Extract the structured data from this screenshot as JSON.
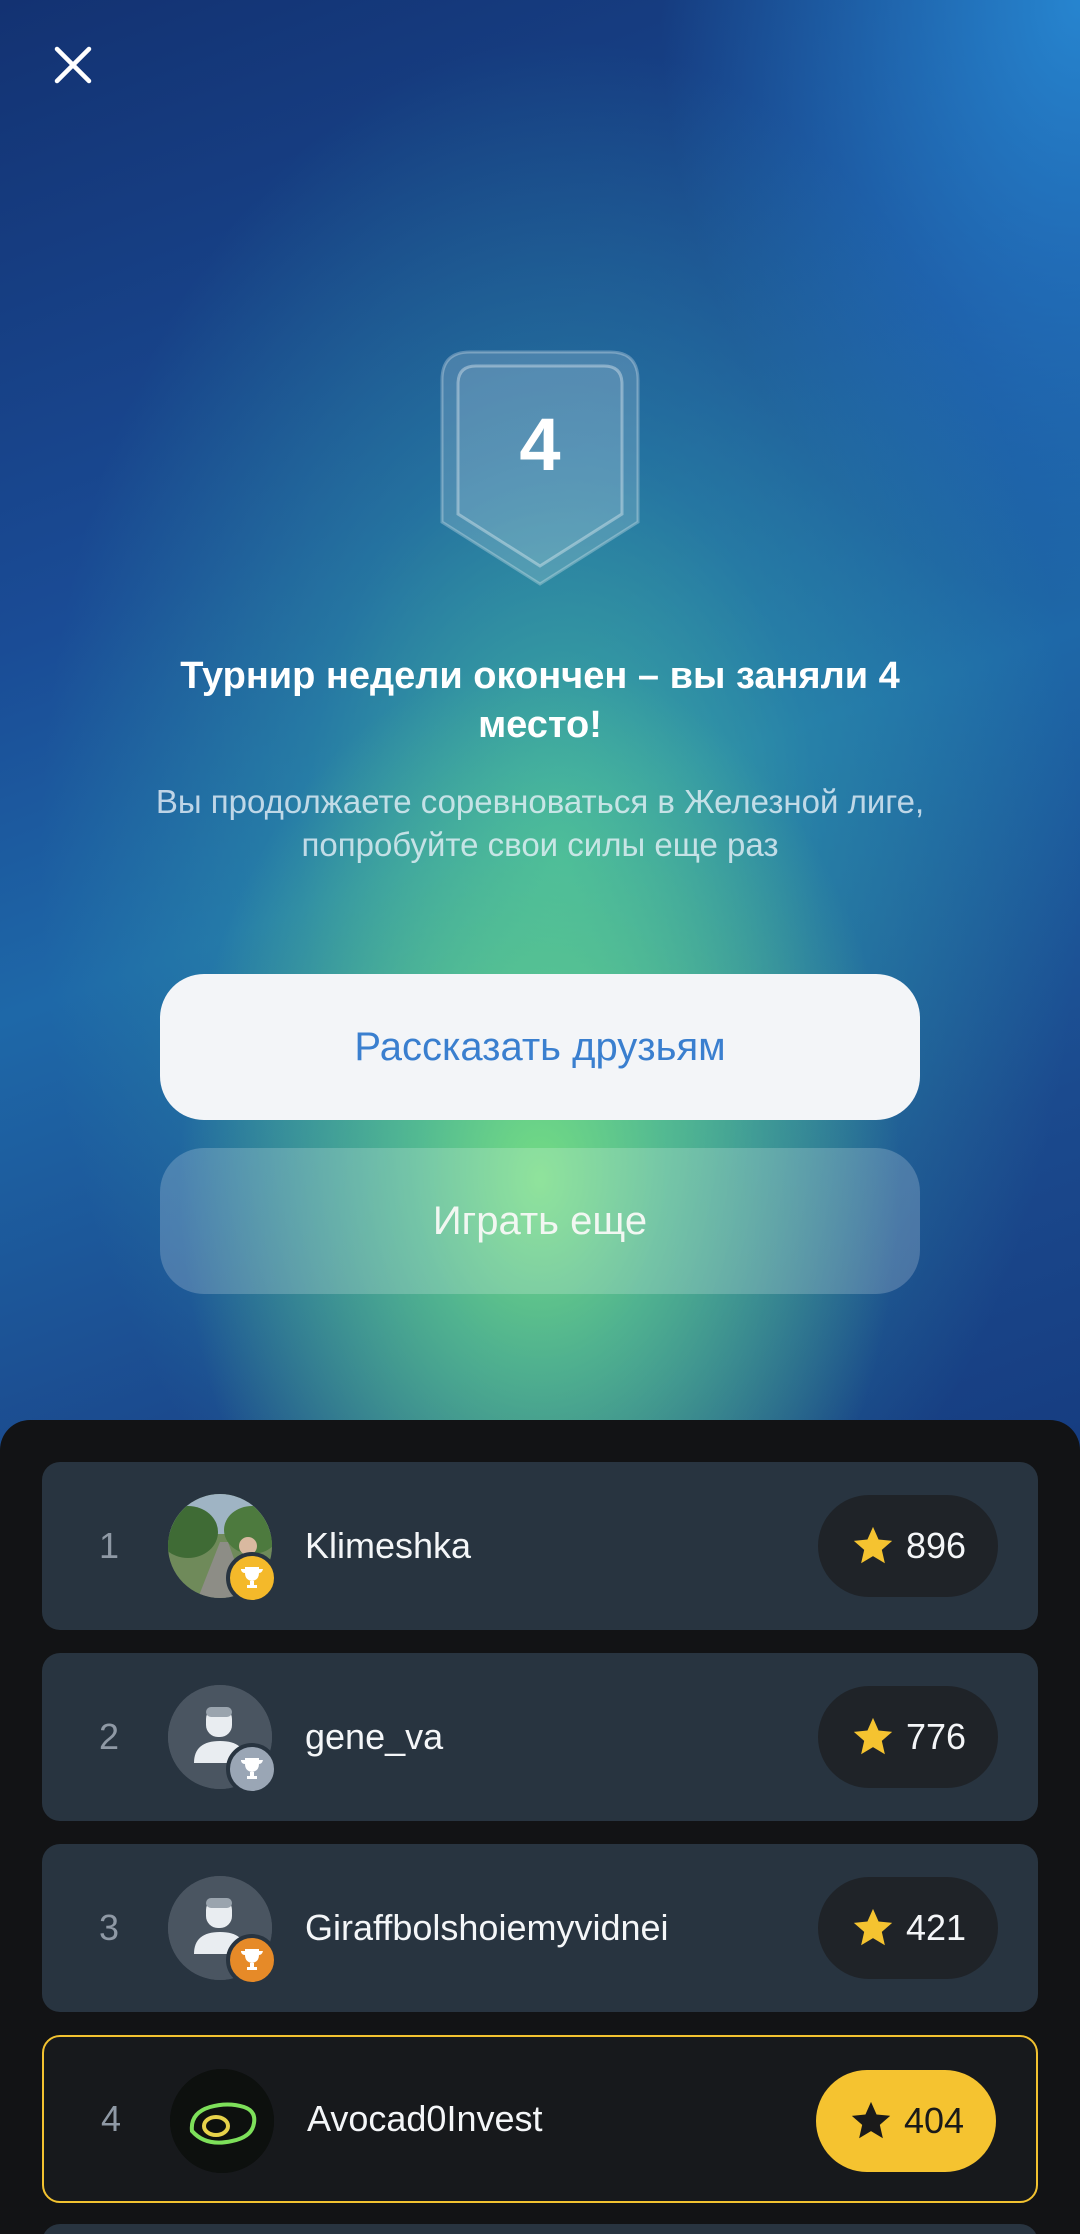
{
  "result": {
    "place": "4",
    "title": "Турнир недели окончен – вы заняли 4 место!",
    "subtitle": "Вы продолжаете соревноваться в Железной лиге, попробуйте свои силы еще раз"
  },
  "buttons": {
    "share_label": "Рассказать друзьям",
    "play_label": "Играть еще"
  },
  "leaderboard": [
    {
      "rank": "1",
      "name": "Klimeshka",
      "score": "896",
      "trophy": "gold"
    },
    {
      "rank": "2",
      "name": "gene_va",
      "score": "776",
      "trophy": "silver"
    },
    {
      "rank": "3",
      "name": "Giraffbolshoiemyvidnei",
      "score": "421",
      "trophy": "bronze"
    },
    {
      "rank": "4",
      "name": "Avocad0Invest",
      "score": "404",
      "is_current_user": true
    }
  ],
  "icons": {
    "close": "close-icon",
    "star": "star-icon",
    "trophy": "trophy-icon"
  },
  "colors": {
    "accent_gold": "#f5c330",
    "link_blue": "#3a7fcf",
    "row_bg": "#283440"
  }
}
